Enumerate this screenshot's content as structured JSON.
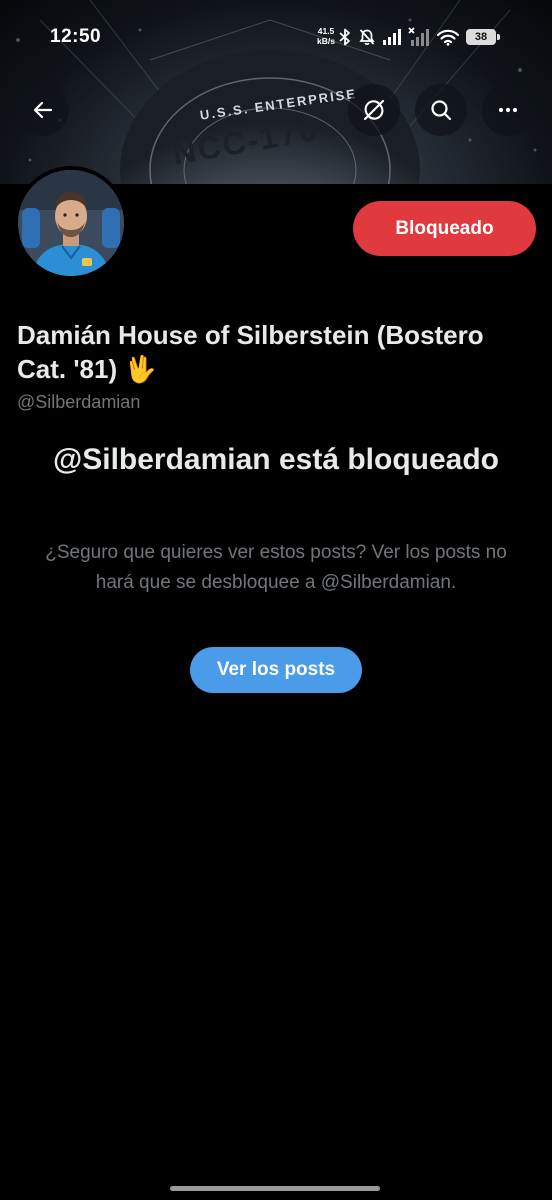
{
  "status_bar": {
    "time": "12:50",
    "net_speed_value": "41.5",
    "net_speed_unit": "kB/s",
    "battery_level": "38",
    "icons": [
      "bluetooth-icon",
      "mute-bell-icon",
      "signal-icon",
      "signal-no-service-icon",
      "wifi-icon",
      "battery-icon"
    ]
  },
  "banner": {
    "text_top": "U.S.S. ENTERPRISE",
    "text_main": "NCC-170"
  },
  "top_bar": {
    "icons": [
      "back-arrow-icon",
      "grok-icon",
      "search-icon",
      "more-options-icon"
    ]
  },
  "profile": {
    "display_name": "Damián House of Silberstein (Bostero Cat. '81)",
    "name_emoji": "🖖",
    "handle": "@Silberdamian",
    "blocked_button_label": "Bloqueado"
  },
  "blocked_notice": {
    "title": "@Silberdamian está bloqueado",
    "description": "¿Seguro que quieres ver estos posts? Ver los posts no hará que se desbloquee a @Silberdamian.",
    "view_button_label": "Ver los posts"
  },
  "colors": {
    "background": "#000000",
    "blocked_button": "#e0393e",
    "view_button": "#4a9be8",
    "primary_text": "#e7e9ea",
    "secondary_text": "#71767b"
  }
}
